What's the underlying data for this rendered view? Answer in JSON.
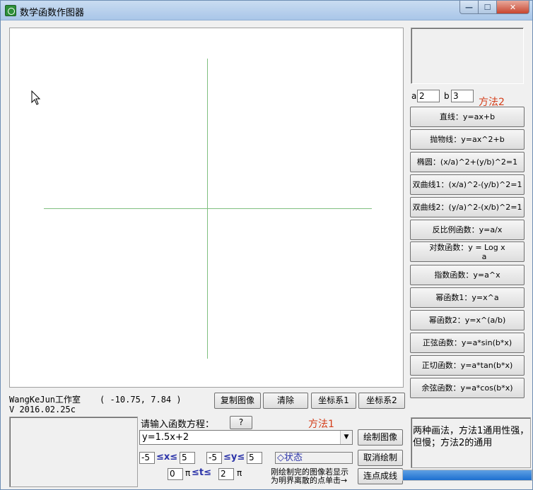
{
  "window": {
    "title": "数学函数作图器"
  },
  "canvas": {
    "cursor": "arrow-cursor-icon"
  },
  "params": {
    "a_label": "a",
    "a_value": "2",
    "b_label": "b",
    "b_value": "3",
    "method2": "方法2"
  },
  "functions": [
    "直线：y=ax+b",
    "抛物线：y=ax^2+b",
    "椭圆：(x/a)^2+(y/b)^2=1",
    "双曲线1：(x/a)^2-(y/b)^2=1",
    "双曲线2：(y/a)^2-(x/b)^2=1",
    "反比例函数：y=a/x",
    "对数函数：y = Log  x",
    "指数函数：y=a^x",
    "幂函数1：y=x^a",
    "幂函数2：y=x^(a/b)",
    "正弦函数：y=a*sin(b*x)",
    "正切函数：y=a*tan(b*x)",
    "余弦函数：y=a*cos(b*x)"
  ],
  "log_sub": "a",
  "status": {
    "studio": "WangKeJun工作室",
    "version": "V 2016.02.25c",
    "coord": "( -10.75,  7.84 )"
  },
  "toolbar": {
    "copy": "复制图像",
    "clear": "清除",
    "coord1": "坐标系1",
    "coord2": "坐标系2"
  },
  "equation": {
    "prompt": "请输入函数方程：",
    "help": "?",
    "method1": "方法1",
    "value": "y=1.5x+2",
    "draw": "绘制图像",
    "cancel": "取消绘制",
    "connect": "连点成线"
  },
  "range": {
    "x_min": "-5",
    "x_op": "≤x≤",
    "x_max": "5",
    "y_min": "-5",
    "y_op": "≤y≤",
    "y_max": "5",
    "t_min": "0",
    "t_pi1": "π",
    "t_op": "≤t≤",
    "t_max": "2",
    "t_pi2": "π",
    "state": "◇状态"
  },
  "note": {
    "line1": "刚绘制完的图像若显示",
    "line2": "为明界离散的点单击→"
  },
  "info": {
    "text": "两种画法，方法1通用性强，但慢；方法2的通用"
  },
  "progress": {
    "value": 1.0
  }
}
